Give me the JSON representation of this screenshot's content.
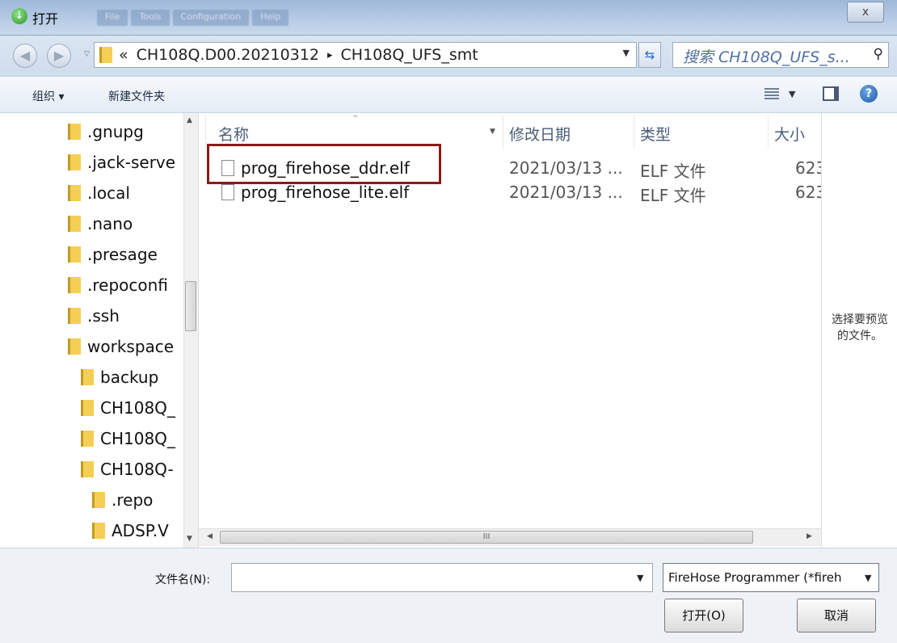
{
  "window": {
    "title": "打开",
    "menu_blur": [
      "File",
      "Tools",
      "Configuration",
      "Help"
    ],
    "close_label": "x"
  },
  "address": {
    "prefix": "«",
    "segments": [
      "CH108Q.D00.20210312",
      "▸",
      "CH108Q_UFS_smt"
    ],
    "search_placeholder": "搜索 CH108Q_UFS_s..."
  },
  "toolbar": {
    "organize_label": "组织 ▾",
    "new_folder_label": "新建文件夹"
  },
  "tree": {
    "items": [
      ".gnupg",
      ".jack-serve",
      ".local",
      ".nano",
      ".presage",
      ".repoconfi",
      ".ssh",
      "workspace",
      "backup",
      "CH108Q_",
      "CH108Q_",
      "CH108Q-",
      ".repo",
      "ADSP.V"
    ]
  },
  "columns": {
    "name": "名称",
    "modified": "修改日期",
    "type": "类型",
    "size": "大小"
  },
  "files": [
    {
      "name": "prog_firehose_ddr.elf",
      "modified": "2021/03/13 ...",
      "type": "ELF 文件",
      "size": "623"
    },
    {
      "name": "prog_firehose_lite.elf",
      "modified": "2021/03/13 ...",
      "type": "ELF 文件",
      "size": "623"
    }
  ],
  "preview": {
    "line1": "选择要预览",
    "line2": "的文件。"
  },
  "bottom": {
    "filename_label": "文件名(N):",
    "filename_value": "",
    "filter_value": "FireHose Programmer (*fireh",
    "open_label": "打开(O)",
    "cancel_label": "取消"
  },
  "colors": {
    "highlight": "#8b1a1a",
    "folder": "#f4cf55"
  }
}
